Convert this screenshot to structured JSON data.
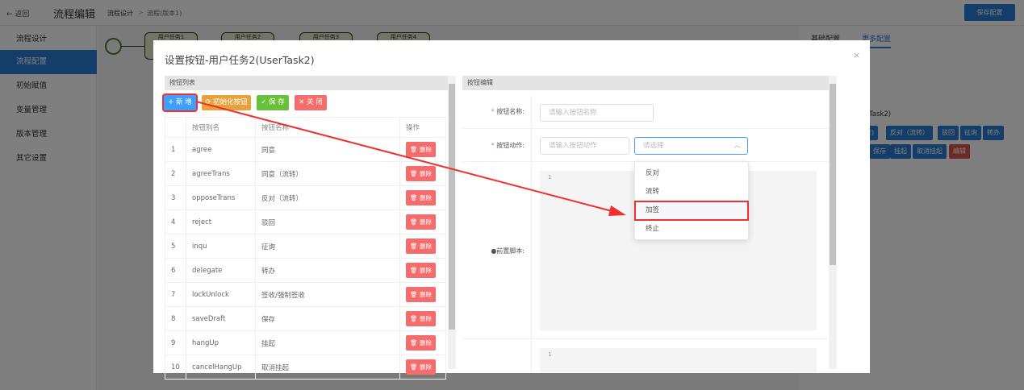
{
  "topbar": {
    "back": "← 返回",
    "title": "流程编辑",
    "breadcrumb": [
      "流程设计",
      ">",
      "流程(版本1)"
    ],
    "save_config": "保存配置"
  },
  "sidebar": {
    "items": [
      {
        "label": "流程设计"
      },
      {
        "label": "流程配置",
        "active": true
      },
      {
        "label": "初始赋值"
      },
      {
        "label": "变量管理"
      },
      {
        "label": "版本管理"
      },
      {
        "label": "其它设置"
      }
    ]
  },
  "canvas": {
    "tasks": [
      "用户任务1",
      "用户任务2",
      "用户任务3",
      "用户任务4"
    ]
  },
  "right_panel": {
    "tabs": [
      "基础配置",
      "更多配置"
    ],
    "task_label": "Task2)",
    "buttons_row1": [
      "转)",
      "反对（流转）",
      "驳回",
      "征询",
      "转办"
    ],
    "buttons_row2": [
      "保存",
      "挂起",
      "取消挂起",
      "编辑"
    ]
  },
  "modal": {
    "title": "设置按钮-用户任务2(UserTask2)",
    "close": "×",
    "list": {
      "header": "按钮列表",
      "add": "+ 新 增",
      "init": "⟳ 初始化按钮",
      "save": "✓ 保 存",
      "close": "✕ 关 闭",
      "columns": [
        "",
        "按钮别名",
        "按钮名称",
        "操作"
      ],
      "delete_label": "删除",
      "rows": [
        [
          "1",
          "agree",
          "同意"
        ],
        [
          "2",
          "agreeTrans",
          "同意（流转）"
        ],
        [
          "3",
          "opposeTrans",
          "反对（流转）"
        ],
        [
          "4",
          "reject",
          "驳回"
        ],
        [
          "5",
          "inqu",
          "征询"
        ],
        [
          "6",
          "delegate",
          "转办"
        ],
        [
          "7",
          "lockUnlock",
          "签收/强制签收"
        ],
        [
          "8",
          "saveDraft",
          "保存"
        ],
        [
          "9",
          "hangUp",
          "挂起"
        ],
        [
          "10",
          "cancelHangUp",
          "取消挂起"
        ]
      ]
    },
    "editor": {
      "header": "按钮编辑",
      "name_label": "按钮名称:",
      "name_placeholder": "请输入按钮名称",
      "action_label": "按钮动作:",
      "action_placeholder": "请输入按钮动作",
      "select_placeholder": "请选择",
      "script_label": "前置脚本:",
      "line_no": "1",
      "options": [
        "反对",
        "流转",
        "加签",
        "终止"
      ],
      "highlighted_option": "加签"
    }
  },
  "colors": {
    "primary": "#2b7bd2",
    "add": "#409eff",
    "init": "#e6a23c",
    "save": "#67c23a",
    "danger": "#f56c6c",
    "annotation": "#f03030"
  }
}
